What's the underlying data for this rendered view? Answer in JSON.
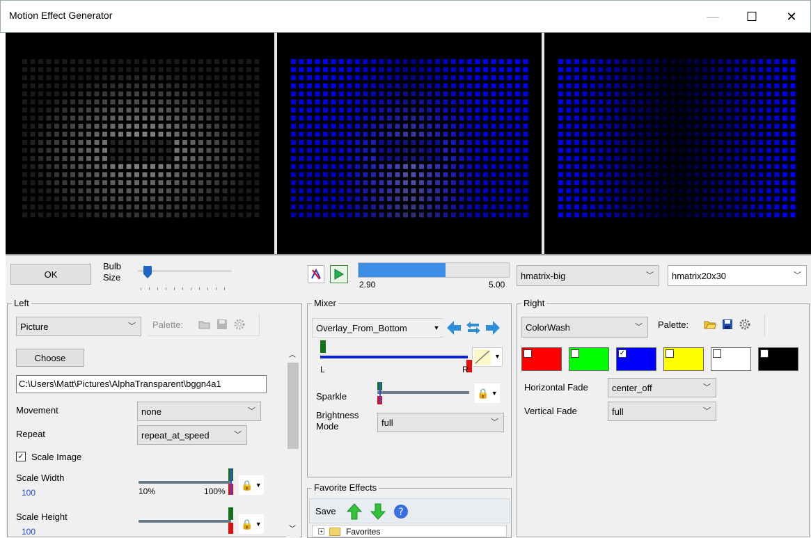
{
  "window": {
    "title": "Motion Effect Generator",
    "minimize": "—",
    "maximize": "☐",
    "close": "✕"
  },
  "toolbar": {
    "ok_label": "OK",
    "bulb_label_1": "Bulb",
    "bulb_label_2": "Size",
    "progress_current": "2.90",
    "progress_total": "5.00",
    "progress_fraction": 0.58,
    "model_select": "hmatrix-big",
    "model_select_2": "hmatrix20x30"
  },
  "left": {
    "group_label": "Left",
    "effect_select": "Picture",
    "palette_label": "Palette:",
    "choose_label": "Choose",
    "path_value": "C:\\Users\\Matt\\Pictures\\AlphaTransparent\\bggn4a1",
    "movement_label": "Movement",
    "movement_value": "none",
    "repeat_label": "Repeat",
    "repeat_value": "repeat_at_speed",
    "scale_image_label": "Scale Image",
    "scale_width_label": "Scale Width",
    "scale_width_value": "100",
    "scale_min": "10%",
    "scale_max": "100%",
    "scale_height_label": "Scale Height",
    "scale_height_value": "100"
  },
  "mixer": {
    "group_label": "Mixer",
    "mode_select": "Overlay_From_Bottom",
    "left_label": "L",
    "right_label": "R",
    "sparkle_label": "Sparkle",
    "brightness_label_1": "Brightness",
    "brightness_label_2": "Mode",
    "brightness_value": "full"
  },
  "favorites": {
    "group_label": "Favorite Effects",
    "save_label": "Save",
    "tree_item": "Favorites"
  },
  "right": {
    "group_label": "Right",
    "effect_select": "ColorWash",
    "palette_label": "Palette:",
    "colors": [
      {
        "hex": "#ff0000",
        "checked": false
      },
      {
        "hex": "#00ff00",
        "checked": false
      },
      {
        "hex": "#0000ff",
        "checked": true
      },
      {
        "hex": "#ffff00",
        "checked": false
      },
      {
        "hex": "#ffffff",
        "checked": false
      },
      {
        "hex": "#000000",
        "checked": false
      }
    ],
    "horizontal_fade_label": "Horizontal Fade",
    "horizontal_fade_value": "center_off",
    "vertical_fade_label": "Vertical Fade",
    "vertical_fade_value": "full"
  }
}
